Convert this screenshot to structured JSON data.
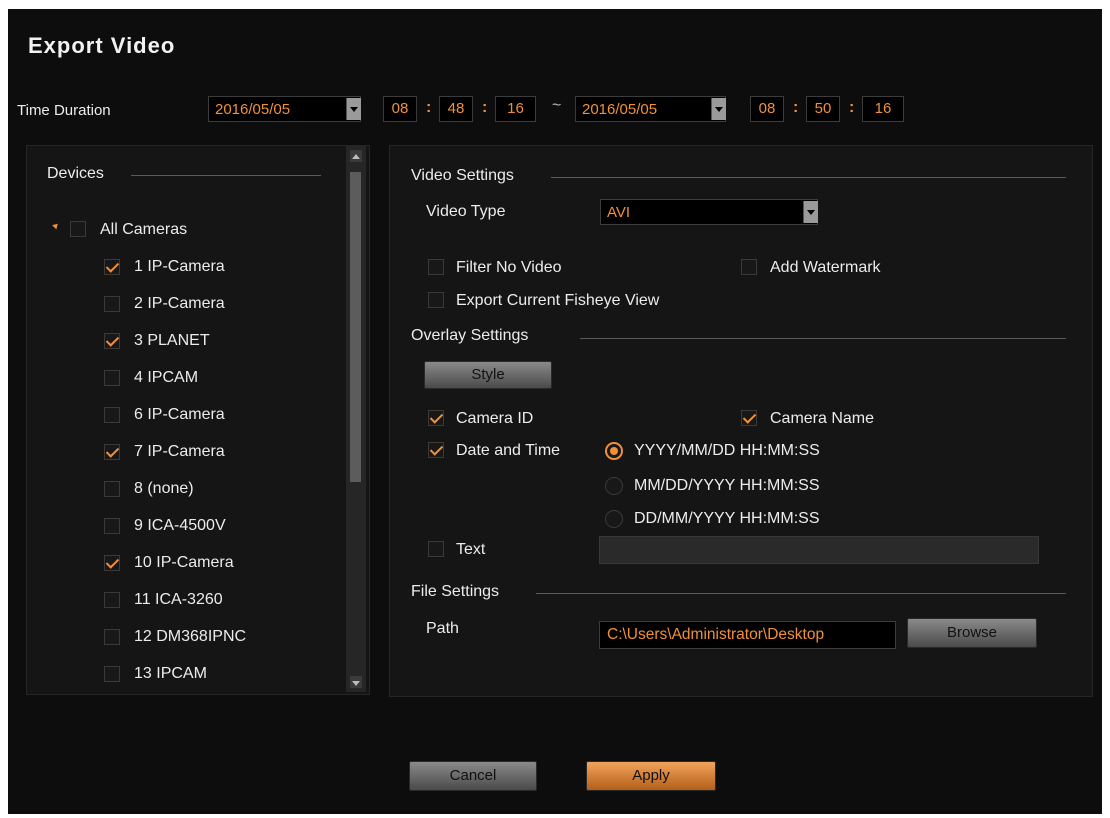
{
  "title": "Export Video",
  "time_duration": {
    "label": "Time Duration",
    "start_date": "2016/05/05",
    "start_h": "08",
    "start_m": "48",
    "start_s": "16",
    "separator": "~",
    "end_date": "2016/05/05",
    "end_h": "08",
    "end_m": "50",
    "end_s": "16"
  },
  "devices": {
    "header": "Devices",
    "all_label": "All Cameras",
    "items": [
      {
        "label": "1 IP-Camera",
        "checked": true
      },
      {
        "label": "2 IP-Camera",
        "checked": false
      },
      {
        "label": "3 PLANET",
        "checked": true
      },
      {
        "label": "4 IPCAM",
        "checked": false
      },
      {
        "label": "6 IP-Camera",
        "checked": false
      },
      {
        "label": "7 IP-Camera",
        "checked": true
      },
      {
        "label": "8 (none)",
        "checked": false
      },
      {
        "label": "9 ICA-4500V",
        "checked": false
      },
      {
        "label": "10 IP-Camera",
        "checked": true
      },
      {
        "label": "11 ICA-3260",
        "checked": false
      },
      {
        "label": "12 DM368IPNC",
        "checked": false
      },
      {
        "label": "13 IPCAM",
        "checked": false
      }
    ]
  },
  "video_settings": {
    "header": "Video Settings",
    "type_label": "Video Type",
    "type_value": "AVI",
    "filter_no_video": "Filter No Video",
    "add_watermark": "Add Watermark",
    "export_fisheye": "Export Current Fisheye View"
  },
  "overlay_settings": {
    "header": "Overlay Settings",
    "style_button": "Style",
    "camera_id": "Camera ID",
    "camera_name": "Camera Name",
    "date_time": "Date and Time",
    "formats": [
      "YYYY/MM/DD HH:MM:SS",
      "MM/DD/YYYY HH:MM:SS",
      "DD/MM/YYYY HH:MM:SS"
    ],
    "selected_format": 0,
    "text_label": "Text",
    "text_value": ""
  },
  "file_settings": {
    "header": "File Settings",
    "path_label": "Path",
    "path_value": "C:\\Users\\Administrator\\Desktop",
    "browse_button": "Browse"
  },
  "buttons": {
    "cancel": "Cancel",
    "apply": "Apply"
  },
  "colors": {
    "accent": "#f0903a",
    "background": "#0d0d0d"
  }
}
